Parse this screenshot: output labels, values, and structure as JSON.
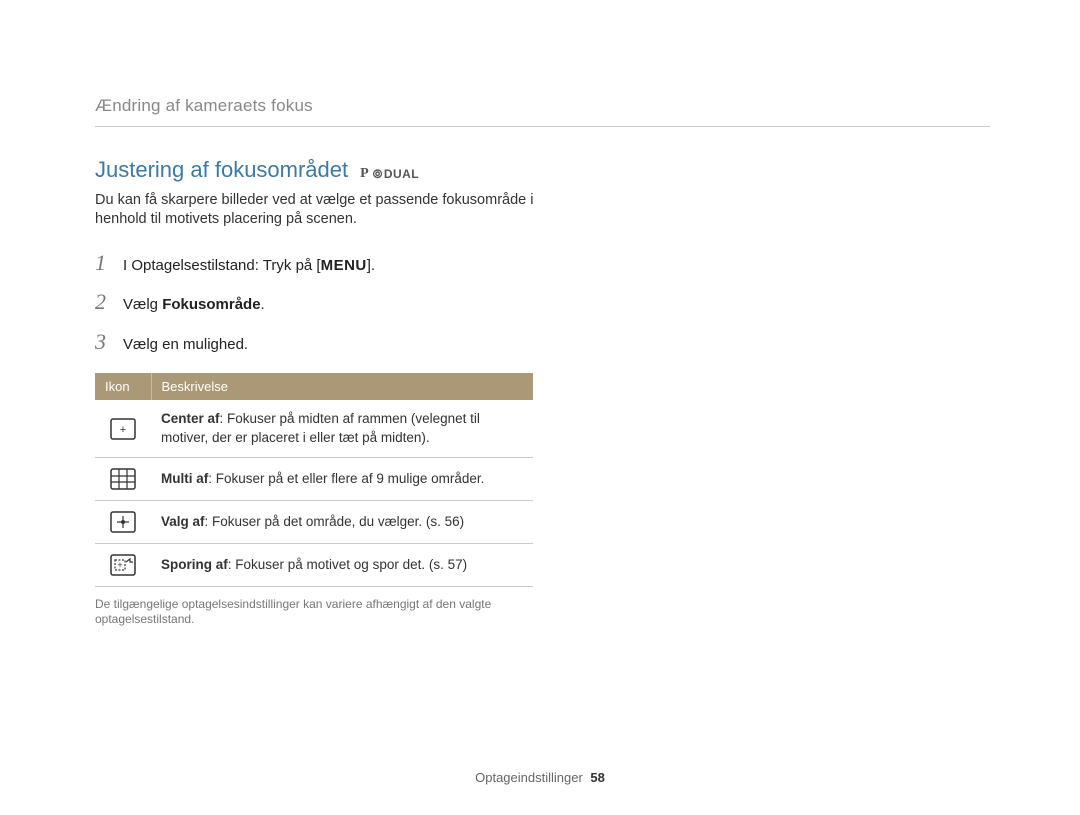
{
  "breadcrumb": "Ændring af kameraets fokus",
  "section": {
    "title": "Justering af fokusområdet",
    "mode_p": "P",
    "mode_dual": "DUAL",
    "intro": "Du kan få skarpere billeder ved at vælge et passende fokusområde i henhold til motivets placering på scenen."
  },
  "steps": {
    "n1": "1",
    "s1_prefix": "I Optagelsestilstand: Tryk på [",
    "s1_menu": "MENU",
    "s1_suffix": "].",
    "n2": "2",
    "s2_prefix": "Vælg ",
    "s2_bold": "Fokusområde",
    "s2_suffix": ".",
    "n3": "3",
    "s3": "Vælg en mulighed."
  },
  "table": {
    "col_icon": "Ikon",
    "col_desc": "Beskrivelse",
    "rows": [
      {
        "name": "Center af",
        "desc": ": Fokuser på midten af rammen (velegnet til motiver, der er placeret i eller tæt på midten)."
      },
      {
        "name": "Multi af",
        "desc": ": Fokuser på et eller flere af 9 mulige områder."
      },
      {
        "name": "Valg af",
        "desc": ": Fokuser på det område, du vælger. (s. 56)"
      },
      {
        "name": "Sporing af",
        "desc": ": Fokuser på motivet og spor det. (s. 57)"
      }
    ]
  },
  "note": "De tilgængelige optagelsesindstillinger kan variere afhængigt af den valgte optagelsestilstand.",
  "footer": {
    "label": "Optageindstillinger",
    "page": "58"
  }
}
